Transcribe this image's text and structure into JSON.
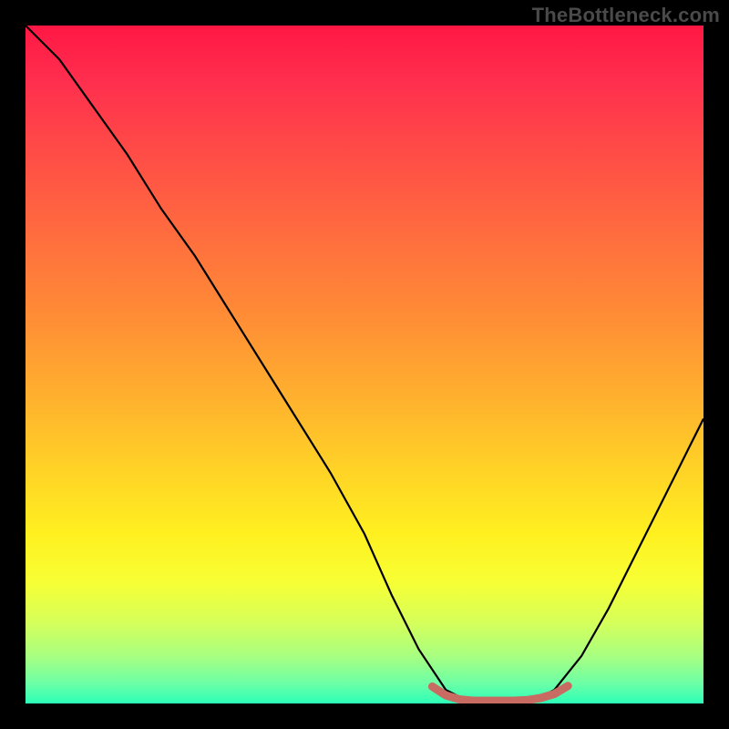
{
  "watermark": "TheBottleneck.com",
  "chart_data": {
    "type": "line",
    "title": "",
    "xlabel": "",
    "ylabel": "",
    "xlim": [
      0,
      100
    ],
    "ylim": [
      0,
      100
    ],
    "grid": false,
    "legend": false,
    "series": [
      {
        "name": "bottleneck-curve",
        "color": "#000000",
        "x": [
          0,
          5,
          10,
          15,
          20,
          25,
          30,
          35,
          40,
          45,
          50,
          54,
          58,
          62,
          66,
          70,
          74,
          78,
          82,
          86,
          90,
          94,
          98,
          100
        ],
        "y": [
          100,
          95,
          88,
          81,
          73,
          66,
          58,
          50,
          42,
          34,
          25,
          16,
          8,
          2,
          0,
          0,
          0,
          2,
          7,
          14,
          22,
          30,
          38,
          42
        ]
      },
      {
        "name": "optimal-zone-marker",
        "color": "#c86b63",
        "x": [
          60,
          62,
          64,
          66,
          68,
          70,
          72,
          74,
          76,
          78,
          80
        ],
        "y": [
          2.5,
          1.2,
          0.6,
          0.4,
          0.4,
          0.4,
          0.4,
          0.5,
          0.8,
          1.4,
          2.6
        ]
      }
    ],
    "gradient_stops": [
      {
        "pos": 0,
        "color": "#ff1744"
      },
      {
        "pos": 50,
        "color": "#ff8a36"
      },
      {
        "pos": 75,
        "color": "#fff020"
      },
      {
        "pos": 100,
        "color": "#2cffb8"
      }
    ]
  }
}
